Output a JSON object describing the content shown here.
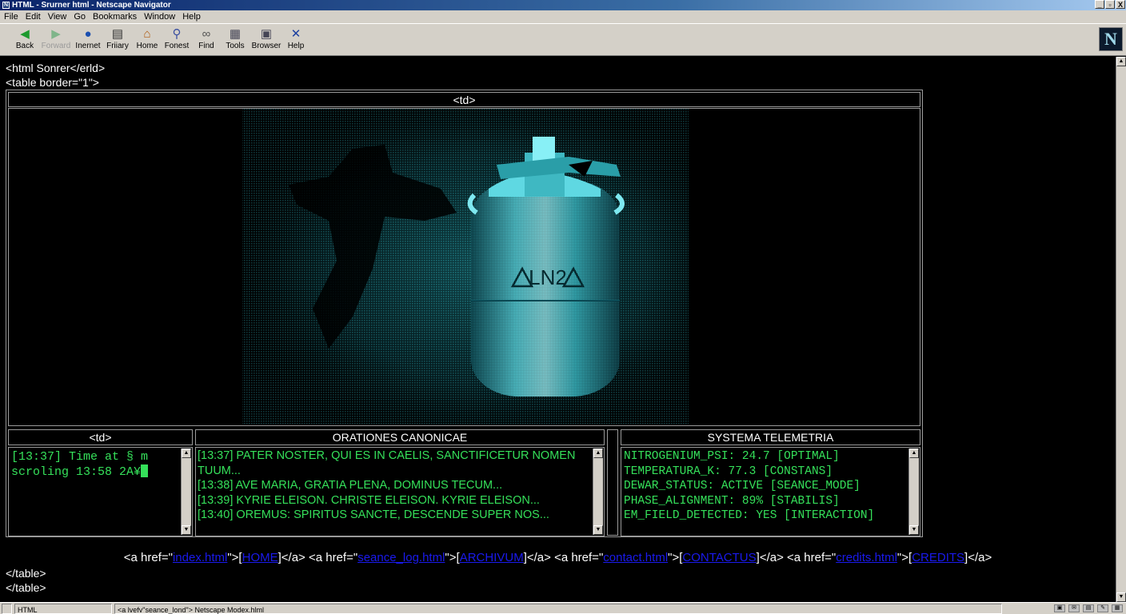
{
  "window": {
    "title": "HTML - Srurner html - Netscape Navigator",
    "controls": [
      "_",
      "▫",
      "X"
    ]
  },
  "menu": [
    "File",
    "Edit",
    "View",
    "Go",
    "Bookmarks",
    "Window",
    "Help"
  ],
  "toolbar": [
    {
      "label": "Back",
      "icon": "back-arrow-icon"
    },
    {
      "label": "Forward",
      "icon": "forward-arrow-icon",
      "disabled": true
    },
    {
      "label": "Inernet",
      "icon": "globe-icon"
    },
    {
      "label": "Friiary",
      "icon": "document-icon"
    },
    {
      "label": "Home",
      "icon": "home-icon"
    },
    {
      "label": "Fonest",
      "icon": "search-icon"
    },
    {
      "label": "Find",
      "icon": "binoculars-icon"
    },
    {
      "label": "Tools",
      "icon": "printer-icon"
    },
    {
      "label": "Browser",
      "icon": "browser-icon"
    },
    {
      "label": "Help",
      "icon": "help-x-icon"
    }
  ],
  "logo": "N",
  "source": {
    "line1": "<html Sonrer</erld>",
    "line2": "<table border=\"1\">",
    "close1": "</table>",
    "close2": "</table>"
  },
  "table": {
    "top_header": "<td>",
    "image_label": "LN2",
    "panels": {
      "left_header": "<td>",
      "left_lines": [
        "[13:37] Time at § m",
        "scroling 13:58 2A¥"
      ],
      "mid_header": "ORATIONES CANONICAE",
      "mid_lines": [
        "[13:37] PATER NOSTER, QUI ES IN CAELIS, SANCTIFICETUR NOMEN TUUM...",
        "[13:38] AVE MARIA, GRATIA PLENA, DOMINUS TECUM...",
        "[13:39] KYRIE ELEISON. CHRISTE ELEISON. KYRIE ELEISON...",
        "[13:40] OREMUS: SPIRITUS SANCTE, DESCENDE SUPER NOS..."
      ],
      "right_header": "SYSTEMA TELEMETRIA",
      "right_lines": [
        "NITROGENIUM_PSI: 24.7 [OPTIMAL]",
        "TEMPERATURA_K: 77.3 [CONSTANS]",
        "DEWAR_STATUS: ACTIVE [SEANCE_MODE]",
        "PHASE_ALIGNMENT: 89% [STABILIS]",
        "EM_FIELD_DETECTED: YES [INTERACTION]"
      ]
    }
  },
  "links": [
    {
      "href": "index.html",
      "text": "HOME"
    },
    {
      "href": "seance_log.html",
      "text": "ARCHIVUM"
    },
    {
      "href": "contact.html",
      "text": "CONTACTUS"
    },
    {
      "href": "credits.html",
      "text": "CREDITS"
    }
  ],
  "status": {
    "left": "HTML",
    "mid": "<a lvefv\"seance_lond\"> Netscape Modex.hlml"
  }
}
